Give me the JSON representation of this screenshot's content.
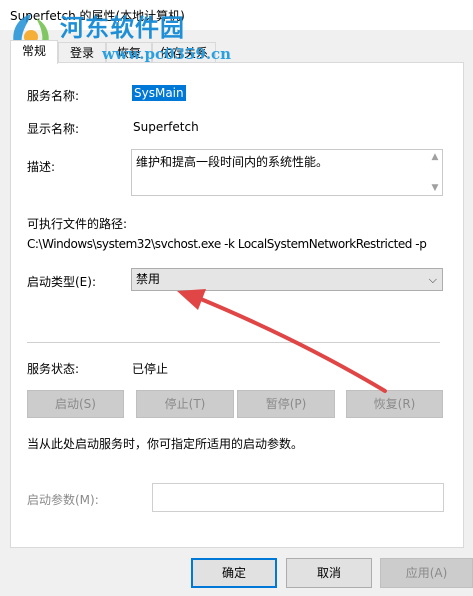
{
  "window": {
    "title": "Superfetch 的属性(本地计算机)"
  },
  "watermark": {
    "name": "河东软件园",
    "url": "www.pc0359.cn"
  },
  "tabs": [
    {
      "label": "常规"
    },
    {
      "label": "登录"
    },
    {
      "label": "恢复"
    },
    {
      "label": "依存关系"
    }
  ],
  "general": {
    "service_name_label": "服务名称:",
    "service_name_value": "SysMain",
    "display_name_label": "显示名称:",
    "display_name_value": "Superfetch",
    "description_label": "描述:",
    "description_value": "维护和提高一段时间内的系统性能。",
    "exe_path_label": "可执行文件的路径:",
    "exe_path_value": "C:\\Windows\\system32\\svchost.exe -k LocalSystemNetworkRestricted -p",
    "startup_type_label": "启动类型(E):",
    "startup_type_value": "禁用",
    "service_status_label": "服务状态:",
    "service_status_value": "已停止",
    "buttons": {
      "start": "启动(S)",
      "stop": "停止(T)",
      "pause": "暂停(P)",
      "resume": "恢复(R)"
    },
    "hint_text": "当从此处启动服务时，你可指定所适用的启动参数。",
    "start_params_label": "启动参数(M):",
    "start_params_value": ""
  },
  "footer": {
    "ok": "确定",
    "cancel": "取消",
    "apply": "应用(A)"
  },
  "colors": {
    "selection": "#0078d7",
    "annotation_arrow": "#e04646",
    "watermark": "#1e8fd6"
  }
}
